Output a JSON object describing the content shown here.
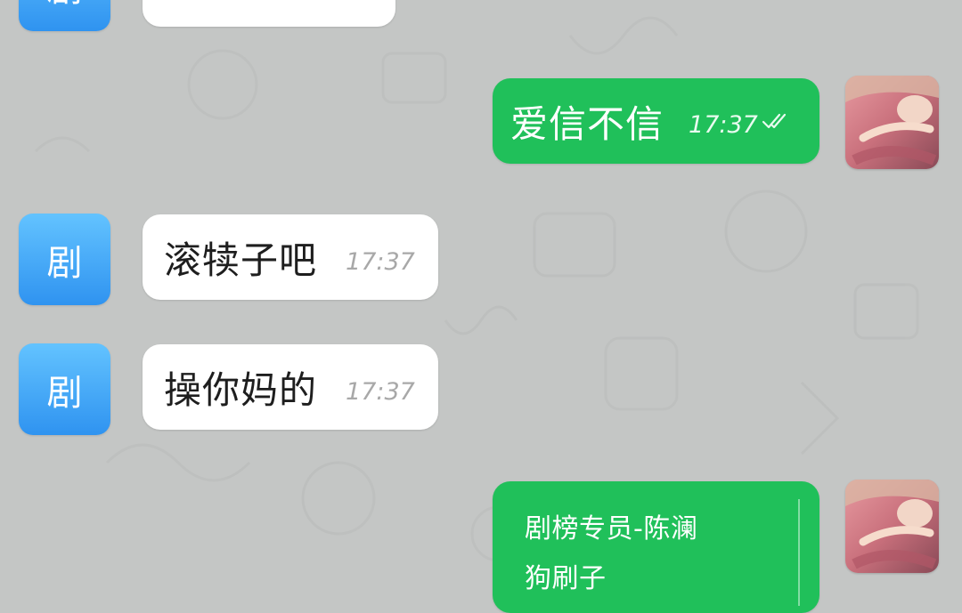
{
  "chat": {
    "messages": [
      {
        "id": "m0",
        "side": "in",
        "avatar_char": "剧",
        "text": "",
        "time": ""
      },
      {
        "id": "m1",
        "side": "out",
        "text": "爱信不信",
        "time": "17:37",
        "status": "read-double-check"
      },
      {
        "id": "m2",
        "side": "in",
        "avatar_char": "剧",
        "text": "滚犊子吧",
        "time": "17:37"
      },
      {
        "id": "m3",
        "side": "in",
        "avatar_char": "剧",
        "text": "操你妈的",
        "time": "17:37"
      },
      {
        "id": "m4",
        "side": "out",
        "lines": [
          "剧榜专员-陈澜",
          "狗刷子"
        ]
      }
    ]
  },
  "colors": {
    "chat_background": "#c4c6c5",
    "outgoing_bubble": "#20c05a",
    "incoming_bubble": "#ffffff",
    "incoming_avatar": "#3aa0f5"
  },
  "icons": {
    "read_status": "double-check-icon",
    "user_avatar": "photo-avatar"
  }
}
